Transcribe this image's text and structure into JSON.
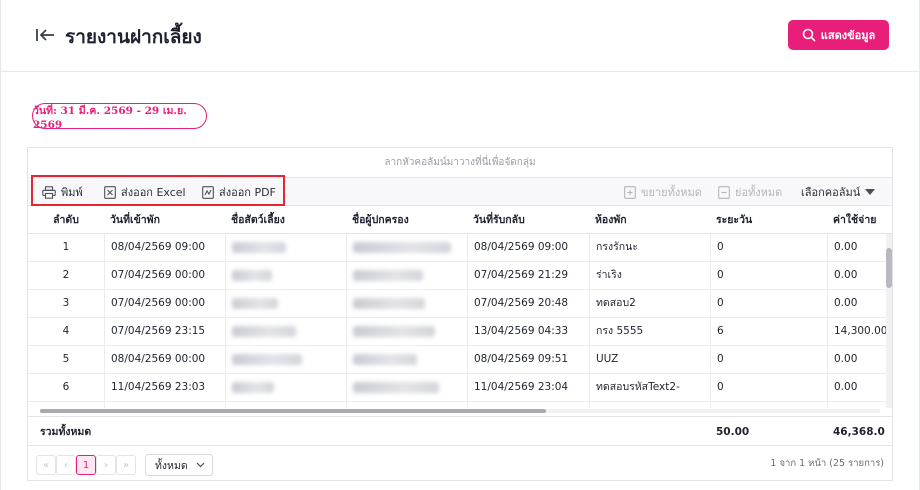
{
  "header": {
    "title": "รายงานฝากเลี้ยง",
    "show_button": "แสดงข้อมูล"
  },
  "filter": {
    "date_range": "วันที่: 31 มี.ค. 2569 - 29 เม.ย. 2569"
  },
  "grid": {
    "group_panel_hint": "ลากหัวคอลัมน์มาวางที่นี่เพื่อจัดกลุ่ม",
    "toolbar": {
      "print": "พิมพ์",
      "export_excel": "ส่งออก Excel",
      "export_pdf": "ส่งออก PDF",
      "expand_all": "ขยายทั้งหมด",
      "collapse_all": "ย่อทั้งหมด",
      "choose_columns": "เลือกคอลัมน์"
    },
    "columns": [
      "ลำดับ",
      "วันที่เข้าพัก",
      "ชื่อสัตว์เลี้ยง",
      "ชื่อผู้ปกครอง",
      "วันที่รับกลับ",
      "ห้องพัก",
      "ระยะวัน",
      "ค่าใช้จ่าย"
    ],
    "rows": [
      {
        "no": "1",
        "checkin": "08/04/2569 09:00",
        "pet": "",
        "owner": "",
        "checkout": "08/04/2569 09:00",
        "room": "กรงรักนะ",
        "days": "0",
        "cost": "0.00"
      },
      {
        "no": "2",
        "checkin": "07/04/2569 00:00",
        "pet": "",
        "owner": "",
        "checkout": "07/04/2569 21:29",
        "room": "ร่าเริง",
        "days": "0",
        "cost": "0.00"
      },
      {
        "no": "3",
        "checkin": "07/04/2569 00:00",
        "pet": "",
        "owner": "",
        "checkout": "07/04/2569 20:48",
        "room": "ทดสอบ2",
        "days": "0",
        "cost": "0.00"
      },
      {
        "no": "4",
        "checkin": "07/04/2569 23:15",
        "pet": "",
        "owner": "",
        "checkout": "13/04/2569 04:33",
        "room": "กรง 5555",
        "days": "6",
        "cost": "14,300.00"
      },
      {
        "no": "5",
        "checkin": "08/04/2569 00:00",
        "pet": "",
        "owner": "",
        "checkout": "08/04/2569 09:51",
        "room": "UUZ",
        "days": "0",
        "cost": "0.00"
      },
      {
        "no": "6",
        "checkin": "11/04/2569 23:03",
        "pet": "",
        "owner": "",
        "checkout": "11/04/2569 23:04",
        "room": "ทดสอบรหัสText2-",
        "days": "0",
        "cost": "0.00"
      }
    ],
    "totals": {
      "label": "รวมทั้งหมด",
      "days": "50.00",
      "cost": "46,368.0"
    },
    "pager": {
      "first": "«",
      "prev": "‹",
      "current_page": "1",
      "next": "›",
      "last": "»",
      "page_size": "ทั้งหมด",
      "info": "1 จาก 1 หน้า (25 รายการ)"
    }
  },
  "colors": {
    "accent": "#e91e7a",
    "highlight_box": "#e32636"
  }
}
